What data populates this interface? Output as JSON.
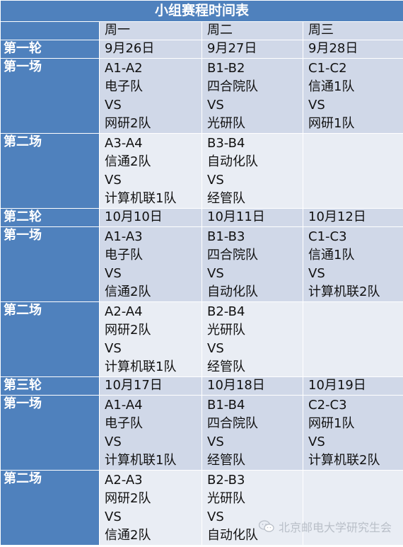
{
  "title": "小组赛程时间表",
  "header": [
    "",
    "周一",
    "周二",
    "周三"
  ],
  "rounds": [
    {
      "label": "第一轮",
      "dates": [
        "9月26日",
        "9月27日",
        "9月28日"
      ],
      "matches": [
        {
          "label": "第一场",
          "cells": [
            [
              "A1-A2",
              "电子队",
              "VS",
              "网研2队"
            ],
            [
              "B1-B2",
              "四合院队",
              "VS",
              "光研队"
            ],
            [
              "C1-C2",
              "信通1队",
              "VS",
              "网研1队"
            ]
          ]
        },
        {
          "label": "第二场",
          "cells": [
            [
              "A3-A4",
              "信通2队",
              "VS",
              "计算机联1队"
            ],
            [
              "B3-B4",
              "自动化队",
              "VS",
              "经管队"
            ],
            []
          ]
        }
      ]
    },
    {
      "label": "第二轮",
      "dates": [
        "10月10日",
        "10月11日",
        "10月12日"
      ],
      "matches": [
        {
          "label": "第一场",
          "cells": [
            [
              "A1-A3",
              "电子队",
              "VS",
              "信通2队"
            ],
            [
              "B1-B3",
              "四合院队",
              "VS",
              "自动化队"
            ],
            [
              "C1-C3",
              "信通1队",
              "VS",
              "计算机联2队"
            ]
          ]
        },
        {
          "label": "第二场",
          "cells": [
            [
              "A2-A4",
              "网研2队",
              "VS",
              "计算机联1队"
            ],
            [
              "B2-B4",
              "光研队",
              "VS",
              "经管队"
            ],
            []
          ]
        }
      ]
    },
    {
      "label": "第三轮",
      "dates": [
        "10月17日",
        "10月18日",
        "10月19日"
      ],
      "matches": [
        {
          "label": "第一场",
          "cells": [
            [
              "A1-A4",
              "电子队",
              "VS",
              "计算机联1队"
            ],
            [
              "B1-B4",
              "四合院队",
              "VS",
              "经管队"
            ],
            [
              "C2-C3",
              "网研1队",
              "VS",
              "计算机联2队"
            ]
          ]
        },
        {
          "label": "第二场",
          "cells": [
            [
              "A2-A3",
              "网研2队",
              "VS",
              "信通2队"
            ],
            [
              "B2-B3",
              "光研队",
              "VS",
              "自动化队"
            ],
            []
          ]
        }
      ]
    }
  ],
  "watermark": "北京邮电大学研究生会",
  "colors": {
    "header_blue": "#4f81bd",
    "shade_dark": "#d0d8e8",
    "shade_light": "#e9edf4"
  }
}
